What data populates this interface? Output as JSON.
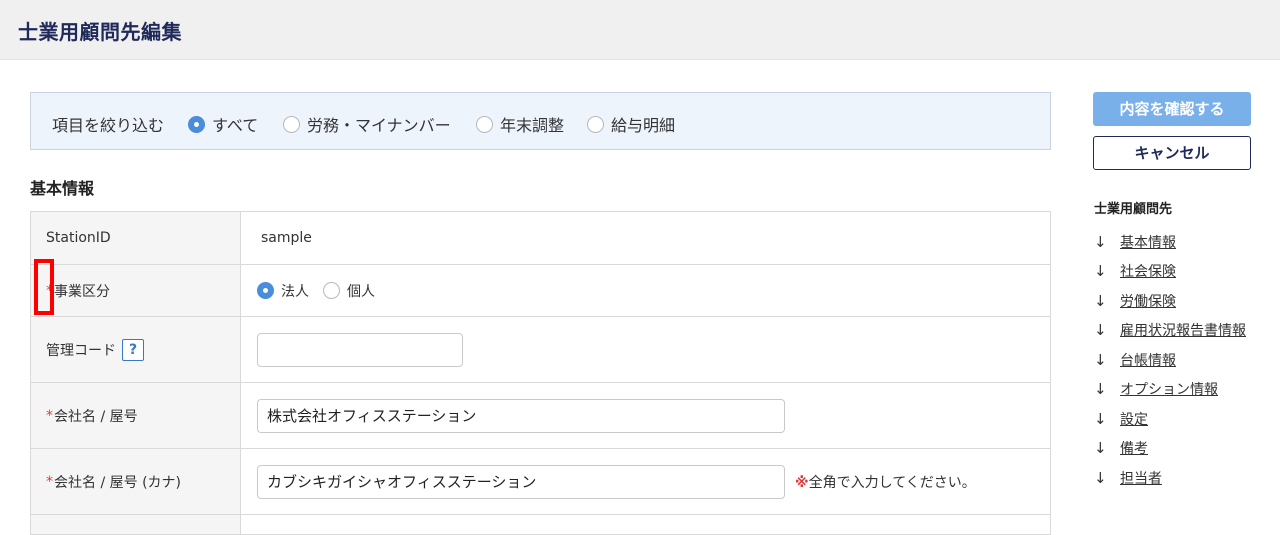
{
  "header": {
    "title": "士業用顧問先編集"
  },
  "filter": {
    "label": "項目を絞り込む",
    "options": [
      {
        "label": "すべて",
        "selected": true
      },
      {
        "label": "労務・マイナンバー",
        "selected": false
      },
      {
        "label": "年末調整",
        "selected": false
      },
      {
        "label": "給与明細",
        "selected": false
      }
    ]
  },
  "section": {
    "title": "基本情報"
  },
  "form": {
    "required_mark": "*",
    "rows": {
      "station_id": {
        "label": "StationID",
        "value": "sample"
      },
      "business_type": {
        "label": "事業区分",
        "options": [
          {
            "label": "法人",
            "selected": true
          },
          {
            "label": "個人",
            "selected": false
          }
        ]
      },
      "management_code": {
        "label": "管理コード",
        "help": "?",
        "value": ""
      },
      "company_name": {
        "label": "会社名 / 屋号",
        "value": "株式会社オフィスステーション"
      },
      "company_name_kana": {
        "label": "会社名 / 屋号 (カナ)",
        "value": "カブシキガイシャオフィスステーション",
        "note_mark": "※",
        "note": "全角で入力してください。"
      }
    }
  },
  "actions": {
    "confirm_label": "内容を確認する",
    "cancel_label": "キャンセル"
  },
  "side_nav": {
    "heading": "士業用顧問先",
    "arrow": "↓",
    "links": [
      "基本情報",
      "社会保険",
      "労働保険",
      "雇用状況報告書情報",
      "台帳情報",
      "オプション情報",
      "設定",
      "備考",
      "担当者"
    ]
  },
  "colors": {
    "accent": "#4a8ddc",
    "title": "#1f2a5a",
    "required": "#e23a3a",
    "highlight": "#ff0000"
  }
}
